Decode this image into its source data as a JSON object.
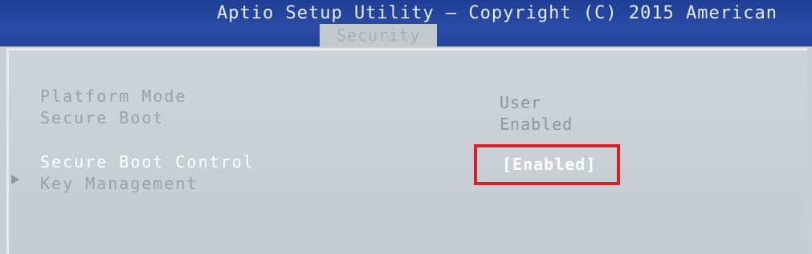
{
  "header": {
    "title": "Aptio Setup Utility – Copyright (C) 2015 American",
    "active_tab": "Security"
  },
  "items": {
    "platform_mode": {
      "label": "Platform Mode",
      "value": "User"
    },
    "secure_boot": {
      "label": "Secure Boot",
      "value": "Enabled"
    },
    "secure_boot_control": {
      "label": "Secure Boot Control",
      "value": "[Enabled]"
    },
    "key_management": {
      "label": "Key Management"
    }
  },
  "colors": {
    "header_bg": "#2a4ca6",
    "panel_bg": "#c9ced4",
    "highlight_border": "#d9202a",
    "selected_text": "#ffffff",
    "dim_text": "#9aa0a8"
  },
  "icons": {
    "submenu_indicator": "triangle-right-icon"
  }
}
